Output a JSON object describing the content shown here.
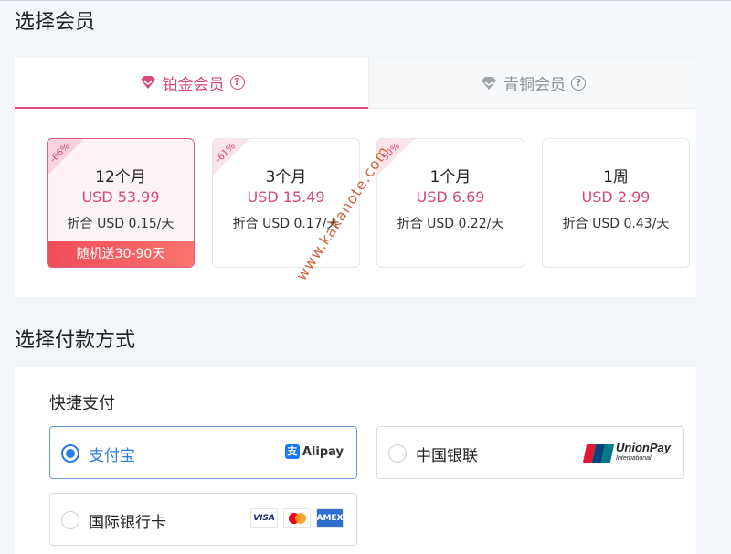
{
  "titles": {
    "choose_membership": "选择会员",
    "choose_payment": "选择付款方式"
  },
  "tabs": [
    {
      "label": "铂金会员",
      "active": true,
      "icon": "diamond-icon",
      "help_icon": "question-circle-icon"
    },
    {
      "label": "青铜会员",
      "active": false,
      "icon": "diamond-icon",
      "help_icon": "question-circle-icon"
    }
  ],
  "plans": [
    {
      "discount": "-66%",
      "name": "12个月",
      "price": "USD 53.99",
      "unit_price": "折合 USD 0.15/天",
      "bonus": "随机送30-90天",
      "selected": true
    },
    {
      "discount": "-61%",
      "name": "3个月",
      "price": "USD 15.49",
      "unit_price": "折合 USD 0.17/天",
      "selected": false
    },
    {
      "discount": "-50%",
      "name": "1个月",
      "price": "USD 6.69",
      "unit_price": "折合 USD 0.22/天",
      "selected": false
    },
    {
      "name": "1周",
      "price": "USD 2.99",
      "unit_price": "折合 USD 0.43/天",
      "selected": false
    }
  ],
  "payment": {
    "section_label": "快捷支付",
    "methods": [
      {
        "label": "支付宝",
        "logo_text": "Alipay",
        "logo_mark": "支",
        "selected": true
      },
      {
        "label": "中国银联",
        "logo_text": "UnionPay",
        "logo_sub": "International",
        "selected": false
      },
      {
        "label": "国际银行卡",
        "logos": [
          "VISA",
          "mastercard",
          "AMEX"
        ],
        "selected": false
      }
    ]
  },
  "watermark": "www.kakanote.com",
  "colors": {
    "accent_pink": "#d8467a",
    "selected_blue": "#2c7be5",
    "bonus_red": "#ef4d58"
  }
}
